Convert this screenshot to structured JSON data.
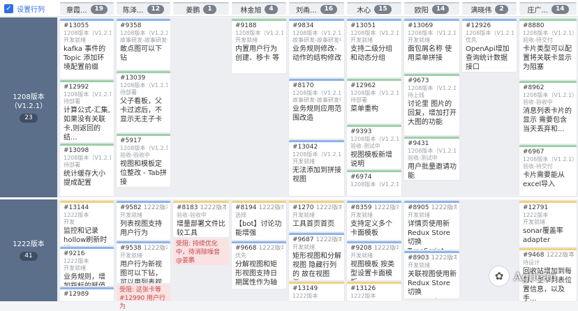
{
  "row_setting": {
    "label": "设置行列",
    "checked": true
  },
  "columns": [
    {
      "name": "章霞...",
      "count": "19"
    },
    {
      "name": "陈泽...",
      "count": "12"
    },
    {
      "name": "姜鹏",
      "count": "1"
    },
    {
      "name": "林金旭",
      "count": "4"
    },
    {
      "name": "刘甬...",
      "count": "16"
    },
    {
      "name": "木心",
      "count": "15"
    },
    {
      "name": "欧阳",
      "count": "14"
    },
    {
      "name": "满晓伟",
      "count": "2"
    },
    {
      "name": "庄广...",
      "count": "14"
    }
  ],
  "lanes": [
    {
      "title": "1208版本（V1.2.1）",
      "count": "23"
    },
    {
      "title": "1222版本",
      "count": "41"
    }
  ],
  "cards": [
    {
      "id": "#13055",
      "ver": "",
      "s1": "1208版本（V1.2.1）",
      "s2": "开发就绪",
      "title": "kafka 事件的Topic 添加环境配置前缀"
    },
    {
      "id": "#12992",
      "ver": "",
      "s1": "1208版本（V1.2.1）",
      "s2": "待部署",
      "title": "计算公式-汇集,如果没有关联卡,则返回的结..."
    },
    {
      "id": "#13098",
      "ver": "",
      "s1": "1208版本（V1.2.1）",
      "s2": "待部署",
      "title": "统计缓存大小提成配置"
    },
    {
      "id": "#9358",
      "ver": "",
      "s1": "1208版本（V1.2.1）",
      "s2": "故事研发-故事研发中",
      "title": "敢点图可以下钻"
    },
    {
      "id": "#13039",
      "ver": "",
      "s1": "1208版本（V1.2.1）",
      "s2": "待部署",
      "title": "父子看板，父卡过滤后，不显示无主子卡"
    },
    {
      "id": "#5917",
      "ver": "",
      "s1": "1208版本（V1.2.1）",
      "s2": "验收-验收中",
      "title": "视图和模板定位整改 - Tab拼接"
    },
    {
      "id": "#9188",
      "ver": "",
      "s1": "1208版本（V1.2.1）",
      "s2": "开发就绪",
      "title": "内置用户行为 创建、移卡 等"
    },
    {
      "id": "#9834",
      "ver": "",
      "s1": "1208版本（V1.2.1）",
      "s2": "故事研发-故事研发中",
      "title": "业务规则修改-动作的结构修改"
    },
    {
      "id": "#8170",
      "ver": "",
      "s1": "1208版本（V1.2.1）",
      "s2": "故事研发-故事研发中",
      "title": "业务规则应用范围改造"
    },
    {
      "id": "#13042",
      "ver": "",
      "s1": "1208版本（V1.2.1）",
      "s2": "开发就绪",
      "title": "无法添加到拼接视图"
    },
    {
      "id": "#13051",
      "ver": "",
      "s1": "1208版本（V1.2.1）",
      "s2": "开发就绪",
      "title": "支持二级分组和动态分组"
    },
    {
      "id": "#12962",
      "ver": "",
      "s1": "1208版本（V1.2.1）",
      "s2": "待部署",
      "title": "菜单重构"
    },
    {
      "id": "#9393",
      "ver": "",
      "s1": "1208版本（V1.2.1）",
      "s2": "验收-测试中",
      "title": "视图模板新增说明"
    },
    {
      "id": "#6974",
      "ver": "",
      "s1": "1208版本（V1.2.1）",
      "s2": "",
      "title": ""
    },
    {
      "id": "#13069",
      "ver": "",
      "s1": "1208版本（V1.2.1）",
      "s2": "开发就绪",
      "title": "面包屑名称 使用菜单拼接"
    },
    {
      "id": "#9673",
      "ver": "",
      "s1": "1208版本（V1.2.1）",
      "s2": "待上线",
      "title": "讨论里 图片的回复，增加打开大图的功能"
    },
    {
      "id": "#9431",
      "ver": "",
      "s1": "1208版本（V1.2.1）",
      "s2": "验收-测试中",
      "title": "用户批量邀请功能"
    },
    {
      "id": "#12926",
      "ver": "",
      "s1": "1208版本（V1.2.1）",
      "s2": "优先",
      "title": "OpenApi增加查询统计数据接口"
    },
    {
      "id": "#8880",
      "ver": "",
      "s1": "1208版本（V1.2.1）",
      "s2": "验收-待交付",
      "title": "卡片类型可以配置将关联卡显示为阻塞"
    },
    {
      "id": "#8962",
      "ver": "",
      "s1": "1208版本（V1.2.1）",
      "s2": "验收-验收中",
      "title": "消息列表卡片的显示 需要包含当天丢弃和..."
    },
    {
      "id": "#6967",
      "ver": "",
      "s1": "1208版本（V1.2.1）",
      "s2": "验收-待交付",
      "title": "卡片需要能从excel导入"
    },
    {
      "id": "#13144",
      "ver": "",
      "s1": "1222版本",
      "s2": "开发",
      "title": "监控和记录hollow刷新时间"
    },
    {
      "id": "#9216",
      "ver": "",
      "s1": "1222版本",
      "s2": "开发就绪",
      "title": "业务规则，增加指标的赋值"
    },
    {
      "id": "#12989",
      "ver": "",
      "s1": "",
      "s2": "",
      "title": ""
    },
    {
      "id": "#9582",
      "ver": "1222版本",
      "s1": "",
      "s2": "开发就绪",
      "title": "列表视图支持 用户行为"
    },
    {
      "id": "#9538",
      "ver": "1222版本",
      "s1": "",
      "s2": "开发就绪",
      "title": "用户行为新视图可以下钻，可以用列表视图打..."
    },
    {
      "id": "#8183",
      "ver": "1222版本",
      "s1": "",
      "s2": "验收-验收中",
      "title": "增量部署文件比较工具"
    },
    {
      "id": "#8194",
      "ver": "1222版本",
      "s1": "",
      "s2": "选择",
      "title": "【bot】讨论功能增强"
    },
    {
      "id": "#9668",
      "ver": "1222版本",
      "s1": "",
      "s2": "优先",
      "title": "分解视图和矩形视图支持日期属性作为轴"
    },
    {
      "id": "#1270",
      "ver": "1222版本",
      "s1": "",
      "s2": "开发就绪",
      "title": "工具首页首页"
    },
    {
      "id": "#9687",
      "ver": "1222版本",
      "s1": "",
      "s2": "开发就绪",
      "title": "矩形视图和分解视图 隐藏行列的 故在视图需..."
    },
    {
      "id": "#13149",
      "ver": "",
      "s1": "1222版本",
      "s2": "",
      "title": ""
    },
    {
      "id": "#8359",
      "ver": "1222版本",
      "s1": "",
      "s2": "开发就绪",
      "title": "支持定义多个卡面模板"
    },
    {
      "id": "#9208",
      "ver": "1222版本",
      "s1": "",
      "s2": "开发就绪",
      "title": "视图模板 按类型设置卡面模板"
    },
    {
      "id": "#13126",
      "ver": "",
      "s1": "1222版本",
      "s2": "",
      "title": ""
    },
    {
      "id": "#8905",
      "ver": "1222版本",
      "s1": "",
      "s2": "开发就绪",
      "title": "详情页使用新Redux Store切换TypeScript"
    },
    {
      "id": "#8903",
      "ver": "1222版本",
      "s1": "",
      "s2": "开发就绪",
      "title": "关联视图使用新Redux Store切换TypeScript"
    },
    {
      "id": "#12791",
      "ver": "",
      "s1": "1222版本",
      "s2": "开发就绪",
      "title": "sonar覆盖率adapter"
    },
    {
      "id": "#9468",
      "ver": "1222版本",
      "s1": "",
      "s2": "待设计",
      "title": "回收站增加到每日、主卡列表位置信息，以及手..."
    }
  ],
  "notes": [
    {
      "text": "受阻: 持续优化中，待消除噪音 @姜鹏"
    },
    {
      "text": "受阻: 这张卡等 #12990 用户行为"
    }
  ],
  "watermark": {
    "text": "Agilean"
  }
}
